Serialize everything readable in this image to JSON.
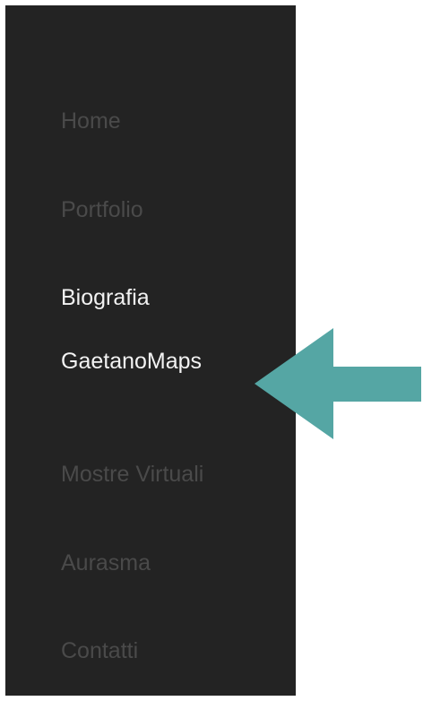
{
  "nav": {
    "items": [
      {
        "label": "Home",
        "state": "dim"
      },
      {
        "label": "Portfolio",
        "state": "dim"
      },
      {
        "label": "Biografia",
        "state": "bright"
      },
      {
        "label": "GaetanoMaps",
        "state": "bright"
      },
      {
        "label": "Mostre Virtuali",
        "state": "dim"
      },
      {
        "label": "Aurasma",
        "state": "dim"
      },
      {
        "label": "Contatti",
        "state": "dim"
      }
    ]
  },
  "colors": {
    "panel_bg": "#232323",
    "item_dim": "#4a4a4a",
    "item_bright": "#f2f2f2",
    "arrow": "#55a6a4"
  },
  "annotation": {
    "icon": "left-arrow-icon",
    "points_to": "GaetanoMaps"
  }
}
